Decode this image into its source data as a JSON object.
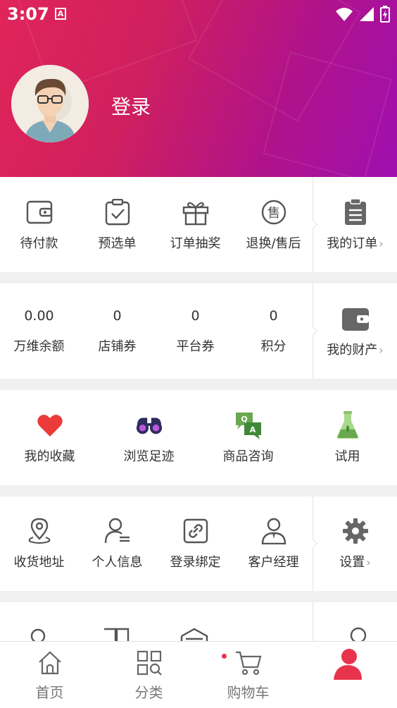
{
  "status_bar": {
    "time": "3:07",
    "a_badge": "A"
  },
  "profile": {
    "login_label": "登录"
  },
  "orders": {
    "items": [
      {
        "label": "待付款",
        "icon": "wallet-icon"
      },
      {
        "label": "预选单",
        "icon": "clipboard-check-icon"
      },
      {
        "label": "订单抽奖",
        "icon": "gift-icon"
      },
      {
        "label": "退换/售后",
        "icon": "after-sale-icon"
      }
    ],
    "side": {
      "label": "我的订单",
      "icon": "order-list-icon"
    },
    "after_sale_glyph": "售"
  },
  "assets": {
    "items": [
      {
        "value": "0.00",
        "label": "万维余额"
      },
      {
        "value": "0",
        "label": "店铺券"
      },
      {
        "value": "0",
        "label": "平台券"
      },
      {
        "value": "0",
        "label": "积分"
      }
    ],
    "side": {
      "label": "我的财产",
      "icon": "wallet-filled-icon"
    }
  },
  "features": {
    "items": [
      {
        "label": "我的收藏",
        "icon": "heart-icon"
      },
      {
        "label": "浏览足迹",
        "icon": "binoculars-icon"
      },
      {
        "label": "商品咨询",
        "icon": "qa-chat-icon"
      },
      {
        "label": "试用",
        "icon": "flask-icon"
      }
    ],
    "qa_q": "Q",
    "qa_a": "A"
  },
  "services": {
    "items": [
      {
        "label": "收货地址",
        "icon": "location-pin-icon"
      },
      {
        "label": "个人信息",
        "icon": "person-info-icon"
      },
      {
        "label": "登录绑定",
        "icon": "link-icon"
      },
      {
        "label": "客户经理",
        "icon": "manager-icon"
      }
    ],
    "side": {
      "label": "设置",
      "icon": "gear-icon"
    }
  },
  "chevron": "›",
  "bottom_nav": {
    "items": [
      {
        "label": "首页",
        "icon": "home-icon"
      },
      {
        "label": "分类",
        "icon": "category-icon"
      },
      {
        "label": "购物车",
        "icon": "cart-icon"
      },
      {
        "label": "",
        "icon": "profile-icon",
        "active": true
      }
    ],
    "accent_color": "#e8334c"
  },
  "colors": {
    "header_start": "#e0255a",
    "header_end": "#a010b0",
    "accent": "#e8334c"
  }
}
